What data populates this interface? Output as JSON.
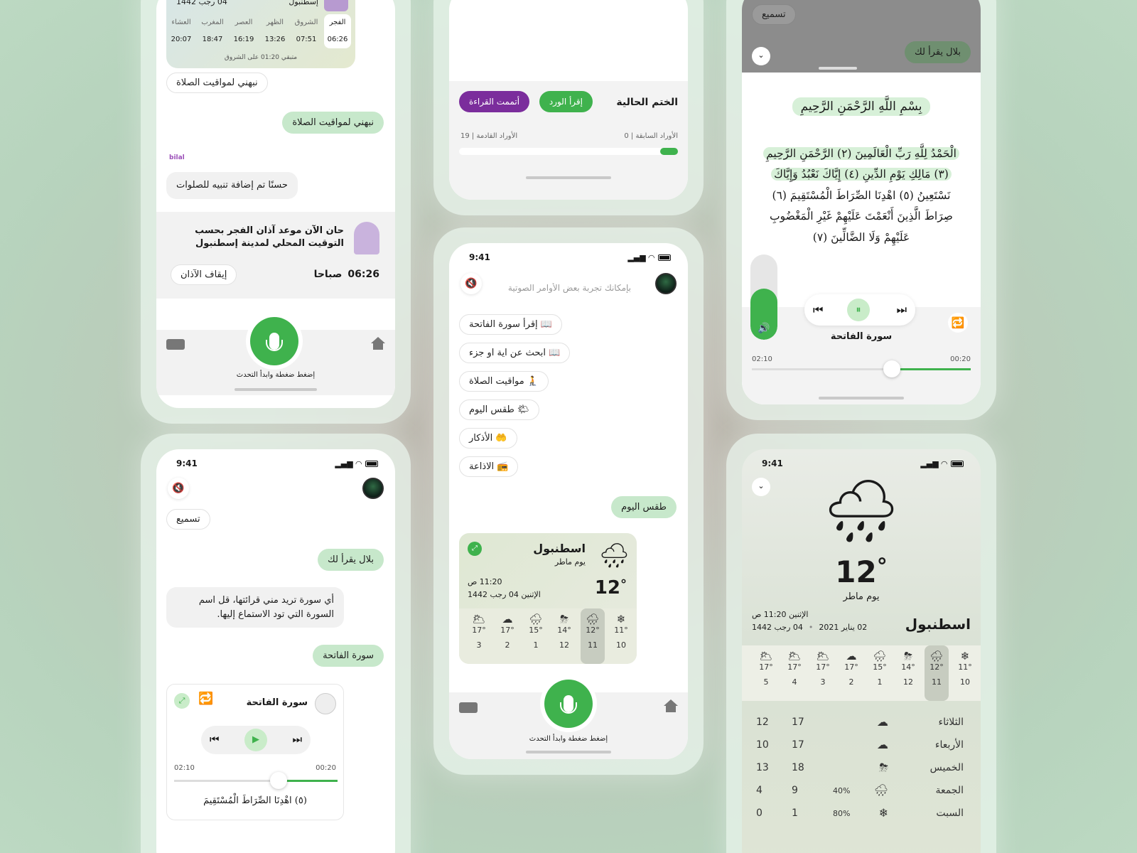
{
  "phone1": {
    "prayer_card": {
      "city": "إسطنبول",
      "date": "04 رجب 1442",
      "names": [
        "الفجر",
        "الشروق",
        "الظهر",
        "العصر",
        "المغرب",
        "العشاء"
      ],
      "times": [
        "06:26",
        "07:51",
        "13:26",
        "16:19",
        "18:47",
        "20:07"
      ],
      "remaining": "متبقي 01:20 على الشروق"
    },
    "chip_notify": "نبهني لمواقيت الصلاة",
    "user_msg": "نبهني لمواقيت الصلاة",
    "logo_text": "bilal",
    "bot_msg": "حسنًا تم إضافة تنبيه للصلوات",
    "alert_title": "حان الآن موعد آذان الفجر بحسب التوقيت المحلي لمدينة إسطنبول",
    "alert_time": "06:26",
    "alert_ampm": "صباحا",
    "stop_adhan": "إيقاف الآذان",
    "press_talk": "إضغط ضغطة وابدأ التحدث"
  },
  "phone2": {
    "khatma_title": "الختم الحالية",
    "read_wird": "إقرأ الورد",
    "done_reading": "أتممت القراءة",
    "prev_wirds": "الأوراد السابقة | 0",
    "next_wirds": "الأوراد القادمة | 19",
    "progress": 0.08
  },
  "phone3": {
    "sama_chip": "تسميع",
    "bilal_reads": "بلال يقرأ لك",
    "basmala": "بِسْمِ اللَّهِ الرَّحْمَنِ الرَّحِيمِ",
    "ayat": [
      "الْحَمْدُ لِلَّهِ رَبِّ الْعَالَمِينَ (٢) الرَّحْمَنِ الرَّحِيمِ",
      "(٣) مَالِكِ يَوْمِ الدِّينِ (٤) إِيَّاكَ نَعْبُدُ وَإِيَّاكَ",
      "نَسْتَعِينُ (٥) اهْدِنَا الصِّرَاطَ الْمُسْتَقِيمَ (٦)",
      "صِرَاطَ الَّذِينَ أَنْعَمْتَ عَلَيْهِمْ غَيْرِ الْمَغْضُوبِ",
      "عَلَيْهِمْ وَلَا الضَّالِّينَ (٧)"
    ],
    "surah": "سورة الفاتحة",
    "elapsed": "00:20",
    "remaining": "02:10",
    "progress": 0.36,
    "volume": 0.6
  },
  "phone4": {
    "time": "9:41",
    "sama_chip": "تسميع",
    "bilal_reads": "بلال يقرأ لك",
    "bot_msg": "أي سورة تريد مني قرائتها، قل اسم السورة التي تود الاستماع إليها.",
    "user_msg": "سورة الفاتحة",
    "surah": "سورة الفاتحة",
    "elapsed": "00:20",
    "remaining": "02:10",
    "progress": 0.36,
    "aya": "(٥) اهْدِنَا الصِّرَاطَ الْمُسْتَقِيمَ"
  },
  "phone5": {
    "time": "9:41",
    "hint": "بإمكانك تجربة بعض الأوامر الصوتية",
    "chips": [
      {
        "label": "إقرأ سورة الفاتحة",
        "icon": "📖"
      },
      {
        "label": "ابحث عن اية او جزء",
        "icon": "📖"
      },
      {
        "label": "مواقيت الصلاة",
        "icon": "🧎"
      },
      {
        "label": "طقس اليوم",
        "icon": "🌤"
      },
      {
        "label": "الأذكار",
        "icon": "🤲"
      },
      {
        "label": "الاذاعة",
        "icon": "📻"
      }
    ],
    "user_msg": "طقس اليوم",
    "weather": {
      "city": "اسطنبول",
      "desc": "يوم ماطر",
      "temp": "12",
      "time": "11:20 ص",
      "date": "الإثنين 04 رجب 1442",
      "hours": [
        {
          "h": "10",
          "t": "11°",
          "i": "❄"
        },
        {
          "h": "11",
          "t": "12°",
          "i": "🌧"
        },
        {
          "h": "12",
          "t": "14°",
          "i": "⛈"
        },
        {
          "h": "1",
          "t": "15°",
          "i": "🌧"
        },
        {
          "h": "2",
          "t": "17°",
          "i": "☁"
        },
        {
          "h": "3",
          "t": "17°",
          "i": "🌥"
        }
      ]
    },
    "press_talk": "إضغط ضغطة وابدأ التحدث"
  },
  "phone6": {
    "time": "9:41",
    "temp": "12",
    "desc": "يوم ماطر",
    "city": "اسطنبول",
    "time_line": "الإثنين 11:20 ص",
    "greg": "02 يناير 2021",
    "hijri": "04 رجب 1442",
    "hours": [
      {
        "h": "10",
        "t": "11°",
        "i": "❄"
      },
      {
        "h": "11",
        "t": "12°",
        "i": "🌧"
      },
      {
        "h": "12",
        "t": "14°",
        "i": "⛈"
      },
      {
        "h": "1",
        "t": "15°",
        "i": "🌧"
      },
      {
        "h": "2",
        "t": "17°",
        "i": "☁"
      },
      {
        "h": "3",
        "t": "17°",
        "i": "🌥"
      },
      {
        "h": "4",
        "t": "17°",
        "i": "🌥"
      },
      {
        "h": "5",
        "t": "17°",
        "i": "🌥"
      }
    ],
    "days": [
      {
        "d": "الثلاثاء",
        "p": "",
        "hi": "17",
        "lo": "12",
        "i": "☁"
      },
      {
        "d": "الأربعاء",
        "p": "",
        "hi": "17",
        "lo": "10",
        "i": "☁"
      },
      {
        "d": "الخميس",
        "p": "",
        "hi": "18",
        "lo": "13",
        "i": "⛈"
      },
      {
        "d": "الجمعة",
        "p": "40%",
        "hi": "9",
        "lo": "4",
        "i": "🌧"
      },
      {
        "d": "السبت",
        "p": "80%",
        "hi": "1",
        "lo": "0",
        "i": "❄"
      }
    ]
  }
}
